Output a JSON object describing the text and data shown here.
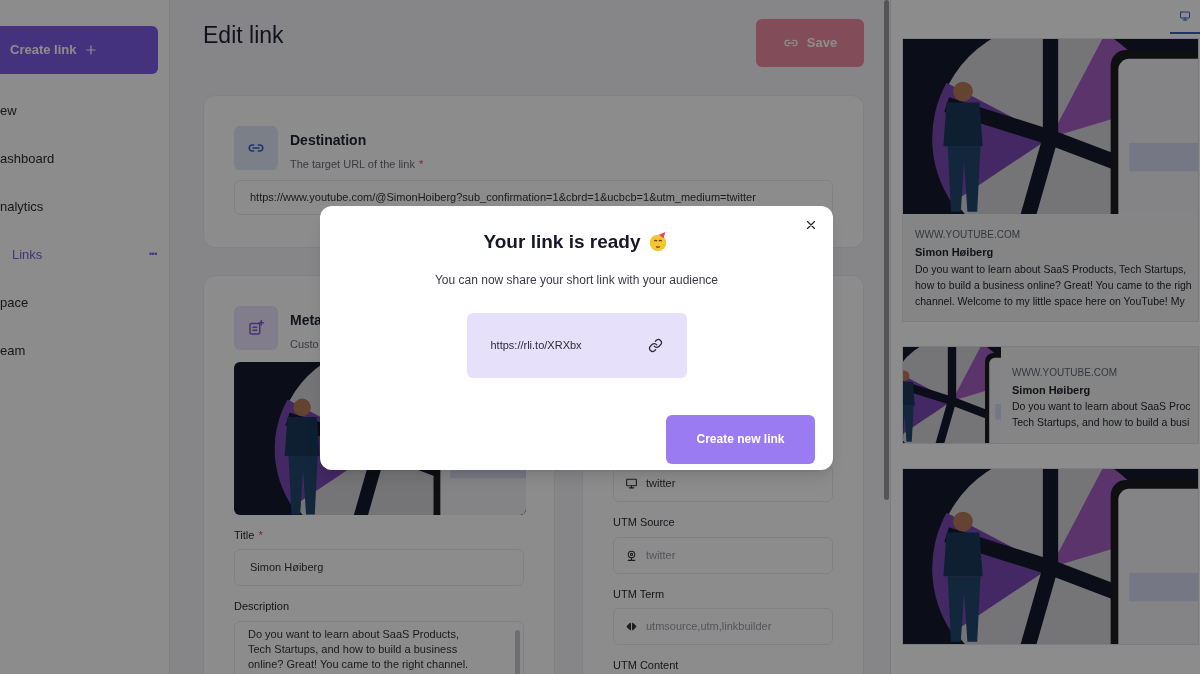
{
  "sidebar": {
    "create_button": "Create link",
    "items": [
      {
        "label": "ew",
        "selected": false
      },
      {
        "label": "ashboard",
        "selected": false
      },
      {
        "label": "nalytics",
        "selected": false
      },
      {
        "label": "Links",
        "selected": true,
        "more": "•••"
      },
      {
        "label": "pace",
        "selected": false
      },
      {
        "label": "eam",
        "selected": false
      }
    ]
  },
  "main": {
    "title": "Edit link",
    "save_button": {
      "label": "Save",
      "disabled": true
    },
    "destination": {
      "title": "Destination",
      "subtitle": "The target URL of the link",
      "required_mark": "*",
      "value": "https://www.youtube.com/@SimonHoiberg?sub_confirmation=1&cbrd=1&ucbcb=1&utm_medium=twitter"
    },
    "metadata": {
      "title": "Meta",
      "subtitle": "Custo",
      "image": {
        "kind": "picture"
      },
      "fields": [
        {
          "kind": "input",
          "label": "Title",
          "required_mark": "*",
          "value": "Simon Høiberg"
        },
        {
          "kind": "textarea",
          "label": "Description",
          "value": "Do you want to learn about SaaS Products, Tech Startups, and how to build a business online? Great! You came to the right channel."
        }
      ]
    },
    "utm": {
      "fields": [
        {
          "kind": "monitor",
          "value": "twitter"
        },
        {
          "kind": "webcam",
          "label": "UTM Source",
          "placeholder": "twitter"
        },
        {
          "kind": "code",
          "label": "UTM Term",
          "placeholder": "utmsource,utm,linkbuilder"
        },
        {
          "kind": "label",
          "label": "UTM Content"
        }
      ]
    }
  },
  "preview": {
    "tabs": [
      {
        "kind": "desktop",
        "selected": true
      }
    ],
    "cards": [
      {
        "kind": "large",
        "image": {
          "kind": "picture"
        },
        "domain": "WWW.YOUTUBE.COM",
        "title": "Simon Høiberg",
        "description_lines": [
          "Do you want to learn about SaaS Products, Tech Startups,",
          "how to build a business online? Great! You came to the righ",
          "channel. Welcome to my little space here on YouTube! My"
        ]
      },
      {
        "kind": "small",
        "image": {
          "kind": "picture"
        },
        "domain": "WWW.YOUTUBE.COM",
        "title": "Simon Høiberg",
        "description_lines": [
          "Do you want to learn about SaaS Proc",
          "Tech Startups, and how to build a busi"
        ]
      },
      {
        "kind": "large",
        "image": {
          "kind": "picture"
        }
      }
    ]
  },
  "modal": {
    "title": "Your link is ready",
    "subtitle": "You can now share your short link with your audience",
    "short_link": "https://rli.to/XRXbx",
    "button": "Create new link"
  }
}
